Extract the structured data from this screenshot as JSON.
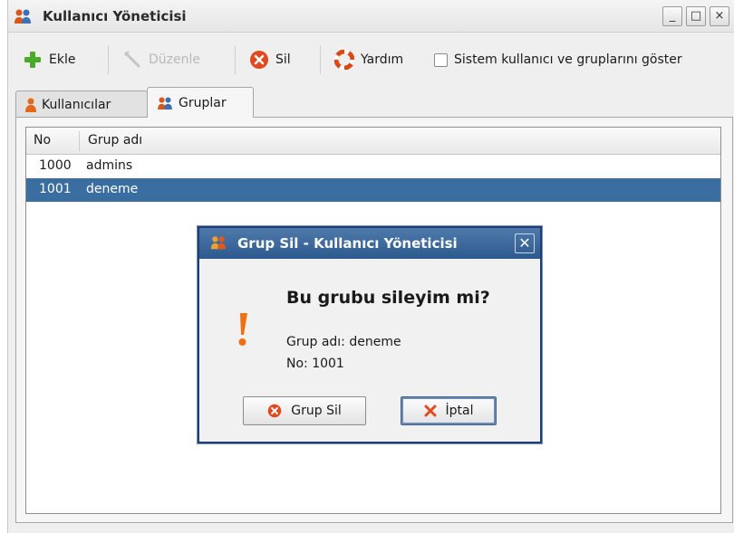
{
  "window": {
    "title": "Kullanıcı Yöneticisi",
    "controls": {
      "minimize": "_",
      "maximize": "□",
      "close": "×"
    }
  },
  "toolbar": {
    "add_label": "Ekle",
    "edit_label": "Düzenle",
    "delete_label": "Sil",
    "help_label": "Yardım",
    "show_system_label": "Sistem kullanıcı ve gruplarını göster",
    "show_system_checked": false
  },
  "tabs": [
    {
      "label": "Kullanıcılar",
      "active": false
    },
    {
      "label": "Gruplar",
      "active": true
    }
  ],
  "table": {
    "columns": [
      "No",
      "Grup adı"
    ],
    "rows": [
      {
        "no": "1000",
        "name": "admins",
        "selected": false
      },
      {
        "no": "1001",
        "name": "deneme",
        "selected": true
      }
    ]
  },
  "dialog": {
    "title": "Grup Sil - Kullanıcı Yöneticisi",
    "close": "✕",
    "heading": "Bu grubu sileyim mi?",
    "group_line": "Grup adı: deneme",
    "no_line": "No: 1001",
    "confirm_label": "Grup Sil",
    "cancel_label": "İptal"
  },
  "colors": {
    "selection": "#3b6ea0",
    "dialog_title": "#2d5a8e",
    "delete_red": "#e04a1e",
    "add_green": "#4caa2a",
    "warning_orange": "#f07010"
  },
  "icons": {
    "app": "users-icon",
    "add": "plus-icon",
    "edit": "edit-icon",
    "delete": "delete-icon",
    "help": "lifebuoy-icon",
    "users_tab": "user-icon",
    "groups_tab": "group-icon",
    "warning": "exclamation-icon",
    "cancel": "cross-icon"
  }
}
